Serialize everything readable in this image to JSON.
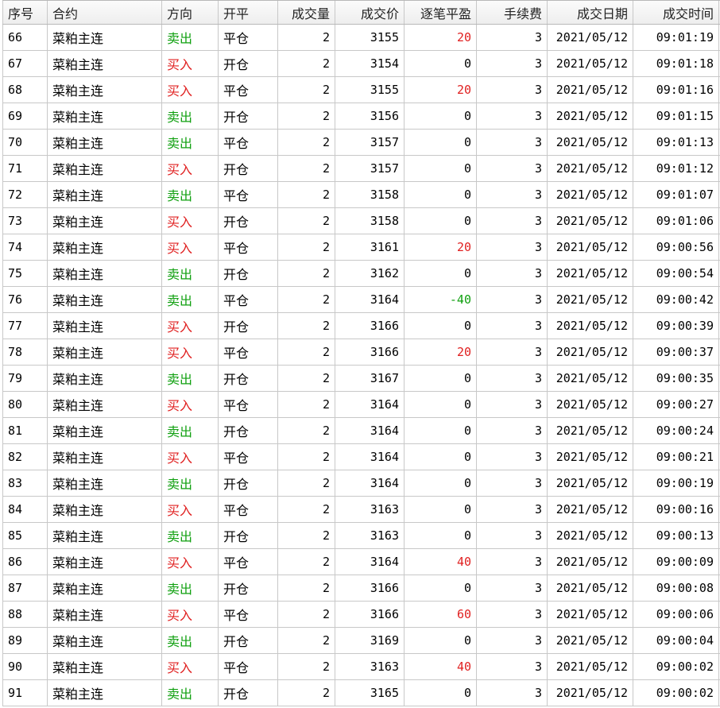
{
  "headers": [
    "序号",
    "合约",
    "方向",
    "开平",
    "成交量",
    "成交价",
    "逐笔平盈",
    "手续费",
    "成交日期",
    "成交时间"
  ],
  "colors": {
    "buy": "#e02020",
    "sell": "#10a010"
  },
  "rows": [
    {
      "id": "66",
      "contract": "菜粕主连",
      "direction": "卖出",
      "dir_type": "sell",
      "openclose": "平仓",
      "volume": "2",
      "price": "3155",
      "pnl": "20",
      "pnl_type": "pos",
      "fee": "3",
      "date": "2021/05/12",
      "time": "09:01:19"
    },
    {
      "id": "67",
      "contract": "菜粕主连",
      "direction": "买入",
      "dir_type": "buy",
      "openclose": "开仓",
      "volume": "2",
      "price": "3154",
      "pnl": "0",
      "pnl_type": "zero",
      "fee": "3",
      "date": "2021/05/12",
      "time": "09:01:18"
    },
    {
      "id": "68",
      "contract": "菜粕主连",
      "direction": "买入",
      "dir_type": "buy",
      "openclose": "平仓",
      "volume": "2",
      "price": "3155",
      "pnl": "20",
      "pnl_type": "pos",
      "fee": "3",
      "date": "2021/05/12",
      "time": "09:01:16"
    },
    {
      "id": "69",
      "contract": "菜粕主连",
      "direction": "卖出",
      "dir_type": "sell",
      "openclose": "开仓",
      "volume": "2",
      "price": "3156",
      "pnl": "0",
      "pnl_type": "zero",
      "fee": "3",
      "date": "2021/05/12",
      "time": "09:01:15"
    },
    {
      "id": "70",
      "contract": "菜粕主连",
      "direction": "卖出",
      "dir_type": "sell",
      "openclose": "平仓",
      "volume": "2",
      "price": "3157",
      "pnl": "0",
      "pnl_type": "zero",
      "fee": "3",
      "date": "2021/05/12",
      "time": "09:01:13"
    },
    {
      "id": "71",
      "contract": "菜粕主连",
      "direction": "买入",
      "dir_type": "buy",
      "openclose": "开仓",
      "volume": "2",
      "price": "3157",
      "pnl": "0",
      "pnl_type": "zero",
      "fee": "3",
      "date": "2021/05/12",
      "time": "09:01:12"
    },
    {
      "id": "72",
      "contract": "菜粕主连",
      "direction": "卖出",
      "dir_type": "sell",
      "openclose": "平仓",
      "volume": "2",
      "price": "3158",
      "pnl": "0",
      "pnl_type": "zero",
      "fee": "3",
      "date": "2021/05/12",
      "time": "09:01:07"
    },
    {
      "id": "73",
      "contract": "菜粕主连",
      "direction": "买入",
      "dir_type": "buy",
      "openclose": "开仓",
      "volume": "2",
      "price": "3158",
      "pnl": "0",
      "pnl_type": "zero",
      "fee": "3",
      "date": "2021/05/12",
      "time": "09:01:06"
    },
    {
      "id": "74",
      "contract": "菜粕主连",
      "direction": "买入",
      "dir_type": "buy",
      "openclose": "平仓",
      "volume": "2",
      "price": "3161",
      "pnl": "20",
      "pnl_type": "pos",
      "fee": "3",
      "date": "2021/05/12",
      "time": "09:00:56"
    },
    {
      "id": "75",
      "contract": "菜粕主连",
      "direction": "卖出",
      "dir_type": "sell",
      "openclose": "开仓",
      "volume": "2",
      "price": "3162",
      "pnl": "0",
      "pnl_type": "zero",
      "fee": "3",
      "date": "2021/05/12",
      "time": "09:00:54"
    },
    {
      "id": "76",
      "contract": "菜粕主连",
      "direction": "卖出",
      "dir_type": "sell",
      "openclose": "平仓",
      "volume": "2",
      "price": "3164",
      "pnl": "-40",
      "pnl_type": "neg",
      "fee": "3",
      "date": "2021/05/12",
      "time": "09:00:42"
    },
    {
      "id": "77",
      "contract": "菜粕主连",
      "direction": "买入",
      "dir_type": "buy",
      "openclose": "开仓",
      "volume": "2",
      "price": "3166",
      "pnl": "0",
      "pnl_type": "zero",
      "fee": "3",
      "date": "2021/05/12",
      "time": "09:00:39"
    },
    {
      "id": "78",
      "contract": "菜粕主连",
      "direction": "买入",
      "dir_type": "buy",
      "openclose": "平仓",
      "volume": "2",
      "price": "3166",
      "pnl": "20",
      "pnl_type": "pos",
      "fee": "3",
      "date": "2021/05/12",
      "time": "09:00:37"
    },
    {
      "id": "79",
      "contract": "菜粕主连",
      "direction": "卖出",
      "dir_type": "sell",
      "openclose": "开仓",
      "volume": "2",
      "price": "3167",
      "pnl": "0",
      "pnl_type": "zero",
      "fee": "3",
      "date": "2021/05/12",
      "time": "09:00:35"
    },
    {
      "id": "80",
      "contract": "菜粕主连",
      "direction": "买入",
      "dir_type": "buy",
      "openclose": "平仓",
      "volume": "2",
      "price": "3164",
      "pnl": "0",
      "pnl_type": "zero",
      "fee": "3",
      "date": "2021/05/12",
      "time": "09:00:27"
    },
    {
      "id": "81",
      "contract": "菜粕主连",
      "direction": "卖出",
      "dir_type": "sell",
      "openclose": "开仓",
      "volume": "2",
      "price": "3164",
      "pnl": "0",
      "pnl_type": "zero",
      "fee": "3",
      "date": "2021/05/12",
      "time": "09:00:24"
    },
    {
      "id": "82",
      "contract": "菜粕主连",
      "direction": "买入",
      "dir_type": "buy",
      "openclose": "平仓",
      "volume": "2",
      "price": "3164",
      "pnl": "0",
      "pnl_type": "zero",
      "fee": "3",
      "date": "2021/05/12",
      "time": "09:00:21"
    },
    {
      "id": "83",
      "contract": "菜粕主连",
      "direction": "卖出",
      "dir_type": "sell",
      "openclose": "开仓",
      "volume": "2",
      "price": "3164",
      "pnl": "0",
      "pnl_type": "zero",
      "fee": "3",
      "date": "2021/05/12",
      "time": "09:00:19"
    },
    {
      "id": "84",
      "contract": "菜粕主连",
      "direction": "买入",
      "dir_type": "buy",
      "openclose": "平仓",
      "volume": "2",
      "price": "3163",
      "pnl": "0",
      "pnl_type": "zero",
      "fee": "3",
      "date": "2021/05/12",
      "time": "09:00:16"
    },
    {
      "id": "85",
      "contract": "菜粕主连",
      "direction": "卖出",
      "dir_type": "sell",
      "openclose": "开仓",
      "volume": "2",
      "price": "3163",
      "pnl": "0",
      "pnl_type": "zero",
      "fee": "3",
      "date": "2021/05/12",
      "time": "09:00:13"
    },
    {
      "id": "86",
      "contract": "菜粕主连",
      "direction": "买入",
      "dir_type": "buy",
      "openclose": "平仓",
      "volume": "2",
      "price": "3164",
      "pnl": "40",
      "pnl_type": "pos",
      "fee": "3",
      "date": "2021/05/12",
      "time": "09:00:09"
    },
    {
      "id": "87",
      "contract": "菜粕主连",
      "direction": "卖出",
      "dir_type": "sell",
      "openclose": "开仓",
      "volume": "2",
      "price": "3166",
      "pnl": "0",
      "pnl_type": "zero",
      "fee": "3",
      "date": "2021/05/12",
      "time": "09:00:08"
    },
    {
      "id": "88",
      "contract": "菜粕主连",
      "direction": "买入",
      "dir_type": "buy",
      "openclose": "平仓",
      "volume": "2",
      "price": "3166",
      "pnl": "60",
      "pnl_type": "pos",
      "fee": "3",
      "date": "2021/05/12",
      "time": "09:00:06"
    },
    {
      "id": "89",
      "contract": "菜粕主连",
      "direction": "卖出",
      "dir_type": "sell",
      "openclose": "开仓",
      "volume": "2",
      "price": "3169",
      "pnl": "0",
      "pnl_type": "zero",
      "fee": "3",
      "date": "2021/05/12",
      "time": "09:00:04"
    },
    {
      "id": "90",
      "contract": "菜粕主连",
      "direction": "买入",
      "dir_type": "buy",
      "openclose": "平仓",
      "volume": "2",
      "price": "3163",
      "pnl": "40",
      "pnl_type": "pos",
      "fee": "3",
      "date": "2021/05/12",
      "time": "09:00:02"
    },
    {
      "id": "91",
      "contract": "菜粕主连",
      "direction": "卖出",
      "dir_type": "sell",
      "openclose": "开仓",
      "volume": "2",
      "price": "3165",
      "pnl": "0",
      "pnl_type": "zero",
      "fee": "3",
      "date": "2021/05/12",
      "time": "09:00:02"
    }
  ]
}
